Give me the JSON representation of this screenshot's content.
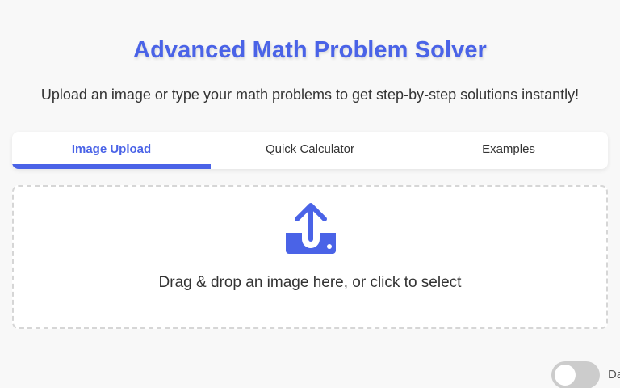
{
  "header": {
    "title": "Advanced Math Problem Solver",
    "subtitle": "Upload an image or type your math problems to get step-by-step solutions instantly!"
  },
  "tabs": [
    {
      "label": "Image Upload",
      "active": true
    },
    {
      "label": "Quick Calculator",
      "active": false
    },
    {
      "label": "Examples",
      "active": false
    }
  ],
  "dropzone": {
    "icon": "upload-icon",
    "text": "Drag & drop an image here, or click to select"
  },
  "theme_toggle": {
    "label": "Da",
    "checked": false
  },
  "colors": {
    "accent": "#4a63e7",
    "background": "#f8f8f8",
    "text": "#333333",
    "toggle_off": "#cccccc"
  }
}
